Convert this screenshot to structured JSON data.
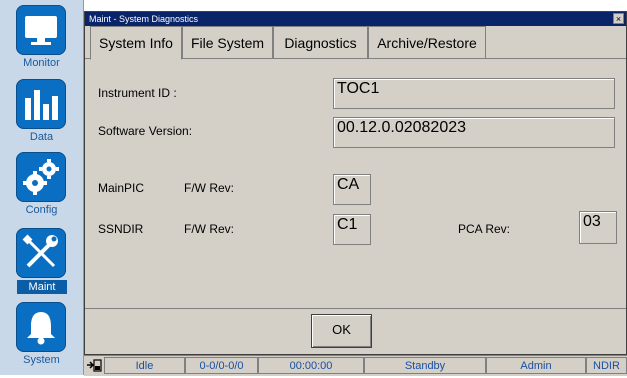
{
  "nav": {
    "items": [
      {
        "label": "Monitor"
      },
      {
        "label": "Data"
      },
      {
        "label": "Config"
      },
      {
        "label": "Maint"
      },
      {
        "label": "System"
      }
    ]
  },
  "dialog": {
    "title": "Maint - System Diagnostics",
    "close": "×",
    "tabs": [
      "System Info",
      "File System",
      "Diagnostics",
      "Archive/Restore"
    ],
    "fields": {
      "instrument_id_label": "Instrument ID :",
      "instrument_id_value": "TOC1",
      "software_version_label": "Software Version:",
      "software_version_value": "00.12.0.02082023",
      "mainpic_label": "MainPIC",
      "mainpic_fw_label": "F/W Rev:",
      "mainpic_fw_value": "CA",
      "ssndir_label": "SSNDIR",
      "ssndir_fw_label": "F/W Rev:",
      "ssndir_fw_value": "C1",
      "pca_rev_label": "PCA Rev:",
      "pca_rev_value": "03"
    },
    "ok_label": "OK"
  },
  "status": {
    "state": "Idle",
    "counter": "0-0/0-0/0",
    "time": "00:00:00",
    "mode": "Standby",
    "user": "Admin",
    "detector": "NDIR"
  },
  "colors": {
    "nav_bg": "#c9d8e8",
    "nav_button": "#0a6fc2",
    "titlebar": "#0a246a",
    "status_text": "#1a4fa0"
  }
}
